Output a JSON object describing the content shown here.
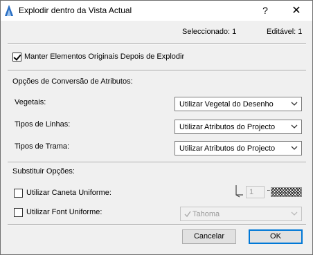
{
  "window": {
    "title": "Explodir dentro da Vista Actual",
    "help_symbol": "?",
    "close_symbol": "✕"
  },
  "status": {
    "selected": "Seleccionado: 1",
    "editable": "Editável: 1"
  },
  "keep_originals": {
    "label": "Manter Elementos Originais Depois de Explodir",
    "checked": true
  },
  "conversion": {
    "heading": "Opções de Conversão de Atributos:",
    "vegetation": {
      "label": "Vegetais:",
      "value": "Utilizar Vegetal do Desenho"
    },
    "line_types": {
      "label": "Tipos de Linhas:",
      "value": "Utilizar Atributos do Projecto"
    },
    "fill_types": {
      "label": "Tipos de Trama:",
      "value": "Utilizar Atributos do Projecto"
    }
  },
  "override": {
    "heading": "Substituir Opções:",
    "uniform_pen": {
      "label": "Utilizar Caneta Uniforme:",
      "checked": false,
      "pen_number": "1"
    },
    "uniform_font": {
      "label": "Utilizar Font Uniforme:",
      "checked": false,
      "font_value": "Tahoma"
    }
  },
  "buttons": {
    "cancel": "Cancelar",
    "ok": "OK"
  },
  "colors": {
    "accent": "#0078d7",
    "window_bg": "#f0f0f0",
    "titlebar_bg": "#ffffff"
  }
}
